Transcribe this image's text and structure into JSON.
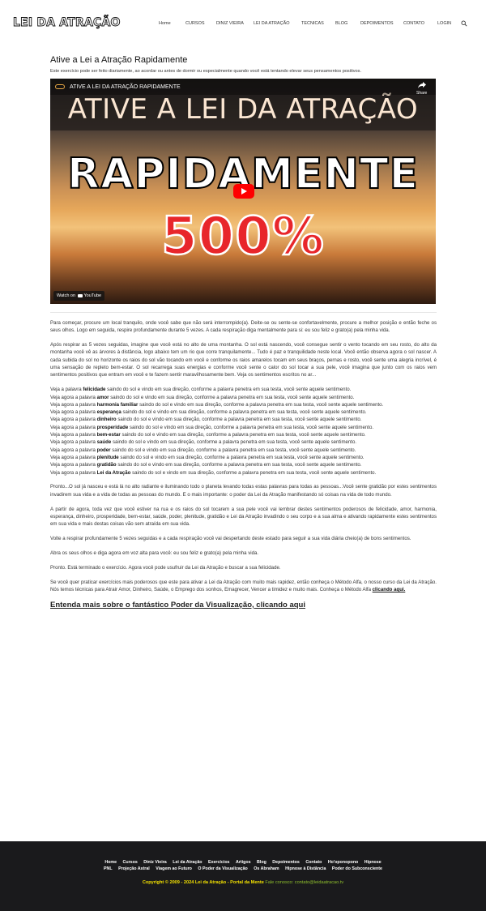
{
  "header": {
    "logo": "LEI DA ATRAÇÃO",
    "nav": [
      "Home",
      "CURSOS",
      "DINIZ VIEIRA",
      "LEI DA ATRAÇÃO",
      "TECNICAS",
      "BLOG",
      "DEPOIMENTOS",
      "CONTATO",
      "LOGIN"
    ],
    "search_icon": "search-icon"
  },
  "article": {
    "title": "Ative a Lei a Atração Rapidamente",
    "subtitle": "Este exercício pode ser feito diariamente, ao acordar ou antes de dormir ou especialmente quando você está tentando elevar seus pensamentos positivos.",
    "video": {
      "title": "ATIVE A LEI DA ATRAÇÃO RAPIDAMENTE",
      "share": "Share",
      "line1": "ATIVE A LEI DA ATRAÇÃO",
      "line2": "RAPIDAMENTE",
      "line3": "500%",
      "watch_on": "Watch on",
      "youtube": "YouTube"
    },
    "p1": "Para começar, procure um local tranquilo, onde você sabe que não será interrompido(a). Deite-se ou sente-se confortavelmente, procure a melhor posição e então feche os seus olhos. Logo em seguida, respire profundamente durante 5 vezes. A cada respiração diga mentalmente para si: eu sou feliz e grato(a) pela minha vida.",
    "p2": "Após respirar as 5 vezes seguidas, imagine que você está no alto de uma montanha. O sol está nascendo, você consegue sentir o vento tocando em seu rosto, do alto da montanha você vê as árvores à distância, logo abaixo tem um rio que corre tranquilamente... Tudo é paz e tranquilidade neste local. Você então observa agora o sol nascer. A cada subida do sol no horizonte os raios do sol vão tocando em você e conforme os raios amarelos tocam em seus braços, pernas e rosto, você sente uma alegria incrível, é uma sensação de repleto bem-estar. O sol recarrega suas energias e conforme você sente o calor do sol tocar a sua pele, você imagina que junto com os raios vem sentimentos positivos que entram em você e te fazem sentir maravilhosamente bem. Veja os sentimentos escritos no ar...",
    "lines_prefix_a": "Veja a palavra",
    "lines_prefix_b": "Veja agora a palavra",
    "lines_suffix_1": "saindo do sol e vindo em sua direção, conforme a palavra penetra em sua testa, você sente aquele sentimento.",
    "words": [
      "felicidade",
      "amor",
      "harmonia familiar",
      "esperança",
      "dinheiro",
      "prosperidade",
      "bem-estar",
      "saúde",
      "poder",
      "plenitude",
      "gratidão",
      "Lei da Atração"
    ],
    "p3": "Pronto...O sol já nasceu e está lá no alto radiante e iluminando todo o planeta levando todas estas palavras para todas as pessoas...Você sente gratidão por estes sentimentos invadirem sua vida e a vida de todas as pessoas do mundo. E o mais importante: o poder da Lei da Atração manifestando só coisas na vida de todo mundo.",
    "p4": "A partir de agora, toda vez que você estiver na rua e os raios do sol tocarem a sua pele você vai lembrar destes sentimentos poderosos de felicidade, amor, harmonia, esperança, dinheiro, prosperidade, bem-estar, saúde, poder, plenitude, gratidão e Lei da Atração invadindo o seu corpo e a sua alma e ativando rapidamente estes sentimentos em sua vida e mais destas coisas vão sem atraída em sua vida.",
    "p5": "Volte a respirar profundamente 5 vezes seguidas e a cada respiração você vai despertando deste estado para seguir a sua vida diária cheio(a) de bons sentimentos.",
    "p6": "Abra os seus olhos e diga agora em voz alta para você: eu sou feliz e grato(a) pela minha vida.",
    "p7": "Pronto. Está terminado o exercício. Agora você pode usufruir da Lei da Atração e buscar a sua felicidade.",
    "p8": "Se você quer praticar exercícios mais poderosos que este para ativar a Lei da Atração com muito mais rapidez, então conheça o Método Alfa, o nosso curso da Lei da Atração. Nós temos técnicas para Atrair Amor, Dinheiro, Saúde, o Emprego dos sonhos, Emagrecer, Vencer a timidez e muito mais. Conheça o Método Alfa",
    "p8_link": "clicando aqui.",
    "cta": "Entenda mais sobre o fantástico Poder da Visualização, clicando aqui"
  },
  "footer": {
    "row1": [
      "Home",
      "Cursos",
      "Diniz Vieira",
      "Lei da Atração",
      "Exercícios",
      "Artigos",
      "Blog",
      "Depoimentos",
      "Contato",
      "Ho'oponopono",
      "Hipnose"
    ],
    "row2": [
      "PNL",
      "Projeção Astral",
      "Viagem ao Futuro",
      "O Poder da Visualização",
      "Os Abraham",
      "Hipnose à Distância",
      "Poder do Subconsciente"
    ],
    "copyright": "Copyright © 2009 - 2024 Lei da Atração - Portal da Mente",
    "contact": "Fale conosco: contato@leidaatracao.tv"
  }
}
